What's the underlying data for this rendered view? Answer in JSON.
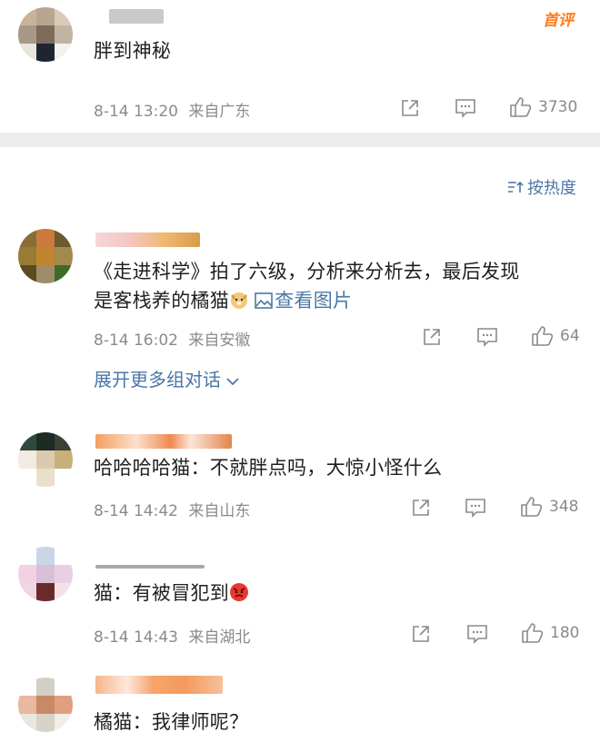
{
  "comments": [
    {
      "text": "胖到神秘",
      "time": "8-14 13:20",
      "source": "来自广东",
      "likes": "3730",
      "badge": "首评"
    },
    {
      "text_line1": "《走进科学》拍了六级，分析来分析去，最后发现",
      "text_line2": "是客栈养的橘猫",
      "view_image": "查看图片",
      "time": "8-14 16:02",
      "source": "来自安徽",
      "likes": "64",
      "expand": "展开更多组对话"
    },
    {
      "text": "哈哈哈哈猫：不就胖点吗，大惊小怪什么",
      "time": "8-14 14:42",
      "source": "来自山东",
      "likes": "348"
    },
    {
      "text": "猫：有被冒犯到",
      "time": "8-14 14:43",
      "source": "来自湖北",
      "likes": "180"
    },
    {
      "text": "橘猫：我律师呢？"
    }
  ],
  "sort_label": "按热度",
  "colors": {
    "link": "#4b77a8",
    "meta": "#8a8a8a",
    "badge": "#ff7a1a",
    "divider": "#ededed"
  }
}
